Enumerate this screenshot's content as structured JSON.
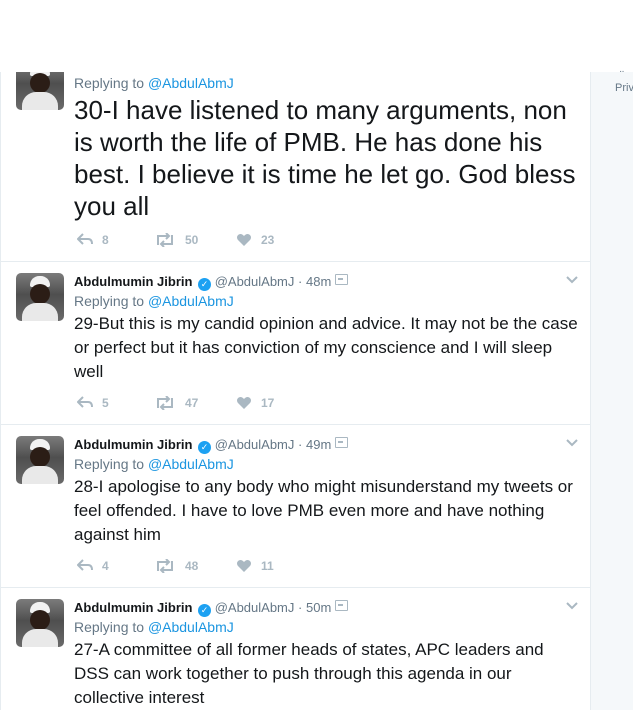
{
  "colors": {
    "link": "#1b95e0",
    "muted": "#657786",
    "action": "#aab8c2",
    "verified": "#1da1f2"
  },
  "sidebar": {
    "privacy_partial": "Priv",
    "dots_partial": "··"
  },
  "tweets": [
    {
      "reply_label": "Replying to ",
      "mention": "@AbdulAbmJ",
      "text": "30-I have listened to many arguments, non is worth the life of PMB. He has done his best. I believe it is time he let go. God bless you all",
      "reply_count": "8",
      "retweet_count": "50",
      "like_count": "23"
    },
    {
      "name": "Abdulmumin Jibrin",
      "handle": "@AbdulAbmJ",
      "time": "48m",
      "reply_label": "Replying to ",
      "mention": "@AbdulAbmJ",
      "text": "29-But this is my candid opinion and advice. It may not be the case or perfect but it has conviction of my conscience and I will sleep well",
      "reply_count": "5",
      "retweet_count": "47",
      "like_count": "17"
    },
    {
      "name": "Abdulmumin Jibrin",
      "handle": "@AbdulAbmJ",
      "time": "49m",
      "reply_label": "Replying to ",
      "mention": "@AbdulAbmJ",
      "text": "28-I apologise to any body who might misunderstand my tweets or feel offended. I have to love PMB even more and have nothing against him",
      "reply_count": "4",
      "retweet_count": "48",
      "like_count": "11"
    },
    {
      "name": "Abdulmumin Jibrin",
      "handle": "@AbdulAbmJ",
      "time": "50m",
      "reply_label": "Replying to ",
      "mention": "@AbdulAbmJ",
      "text": "27-A committee of all former heads of states, APC leaders and DSS can work together to push through this agenda in our collective interest"
    }
  ]
}
